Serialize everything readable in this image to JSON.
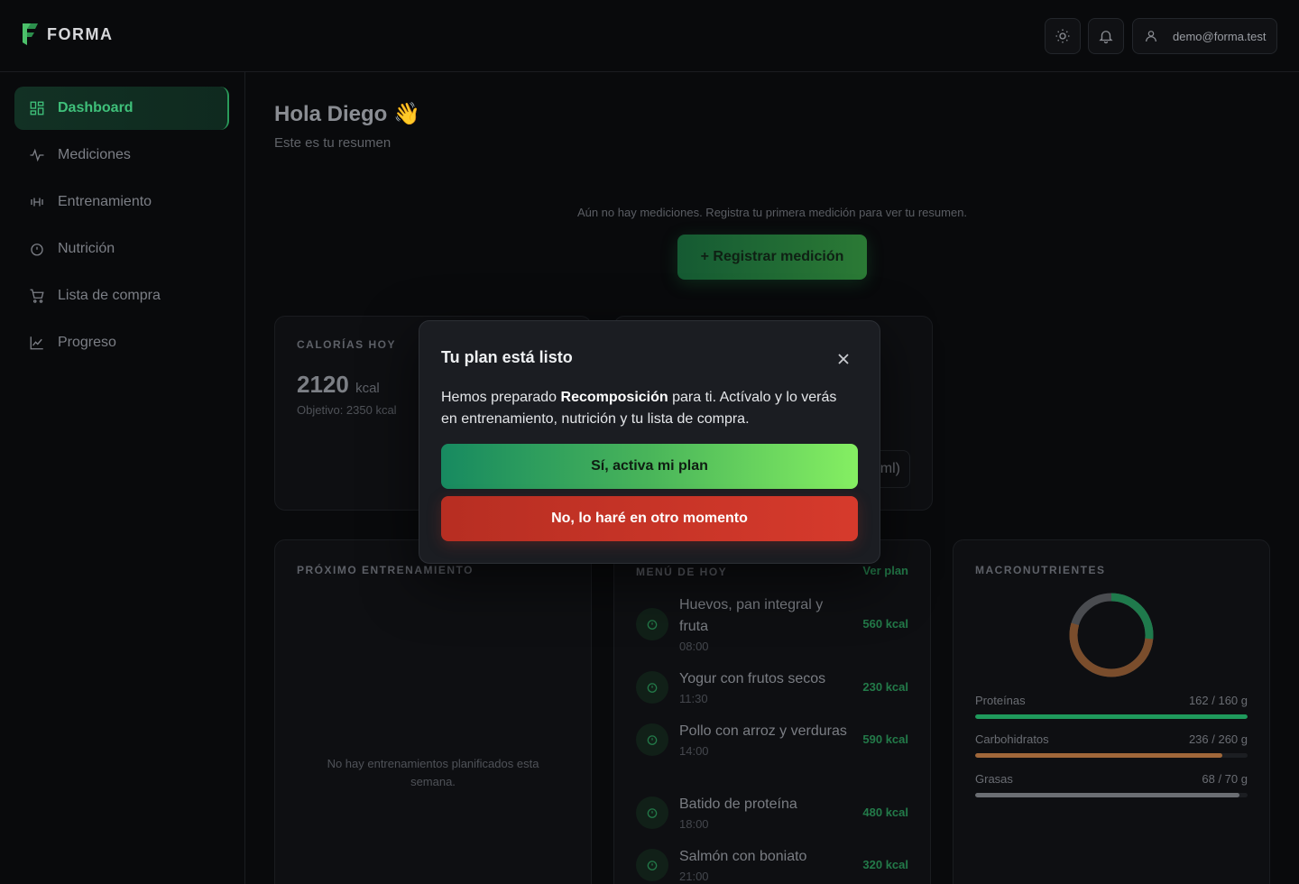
{
  "header": {
    "brand": "FORMA",
    "user_email": "demo@forma.test"
  },
  "sidebar": {
    "items": [
      {
        "label": "Dashboard",
        "icon": "dashboard-icon",
        "active": true
      },
      {
        "label": "Mediciones",
        "icon": "activity-icon",
        "active": false
      },
      {
        "label": "Entrenamiento",
        "icon": "dumbbell-icon",
        "active": false
      },
      {
        "label": "Nutrición",
        "icon": "timer-icon",
        "active": false
      },
      {
        "label": "Lista de compra",
        "icon": "cart-icon",
        "active": false
      },
      {
        "label": "Progreso",
        "icon": "chart-line-icon",
        "active": false
      }
    ]
  },
  "main": {
    "greeting": "Hola Diego 👋",
    "subtitle": "Este es tu resumen",
    "empty_message": "Aún no hay mediciones. Registra tu primera medición para ver tu resumen.",
    "register_button": "+ Registrar medición",
    "calories": {
      "title": "CALORÍAS HOY",
      "value": "2120",
      "unit": "kcal",
      "goal": "Objetivo: 2350 kcal"
    },
    "water_pill": "ml)",
    "next_training": {
      "title": "PRÓXIMO ENTRENAMIENTO",
      "empty": "No hay entrenamientos planificados esta semana."
    },
    "menu": {
      "title": "MENÚ DE HOY",
      "link": "Ver plan",
      "meals": [
        {
          "name": "Huevos, pan integral y fruta",
          "time": "08:00",
          "kcal": "560 kcal"
        },
        {
          "name": "Yogur con frutos secos",
          "time": "11:30",
          "kcal": "230 kcal"
        },
        {
          "name": "Pollo con arroz y verduras",
          "time": "14:00",
          "kcal": "590 kcal"
        },
        {
          "name": "Batido de proteína",
          "time": "18:00",
          "kcal": "480 kcal"
        },
        {
          "name": "Salmón con boniato",
          "time": "21:00",
          "kcal": "320 kcal"
        }
      ]
    },
    "macros": {
      "title": "MACRONUTRIENTES",
      "items": [
        {
          "label": "Proteínas",
          "value": "162 / 160 g",
          "fraction": 1.0,
          "color": "#1f9a5c"
        },
        {
          "label": "Carbohidratos",
          "value": "236 / 260 g",
          "fraction": 0.908,
          "color": "#a0673a"
        },
        {
          "label": "Grasas",
          "value": "68 / 70 g",
          "fraction": 0.971,
          "color": "#6b6e73"
        }
      ]
    }
  },
  "modal": {
    "title": "Tu plan está listo",
    "text_before": "Hemos preparado ",
    "plan_name": "Recomposición",
    "text_after": " para ti. Actívalo y lo verás en entrenamiento, nutrición y tu lista de compra.",
    "confirm": "Sí, activa mi plan",
    "decline": "No, lo haré en otro momento"
  },
  "colors": {
    "accent_green": "#2a9a5a",
    "danger_red": "#d63a2c"
  }
}
